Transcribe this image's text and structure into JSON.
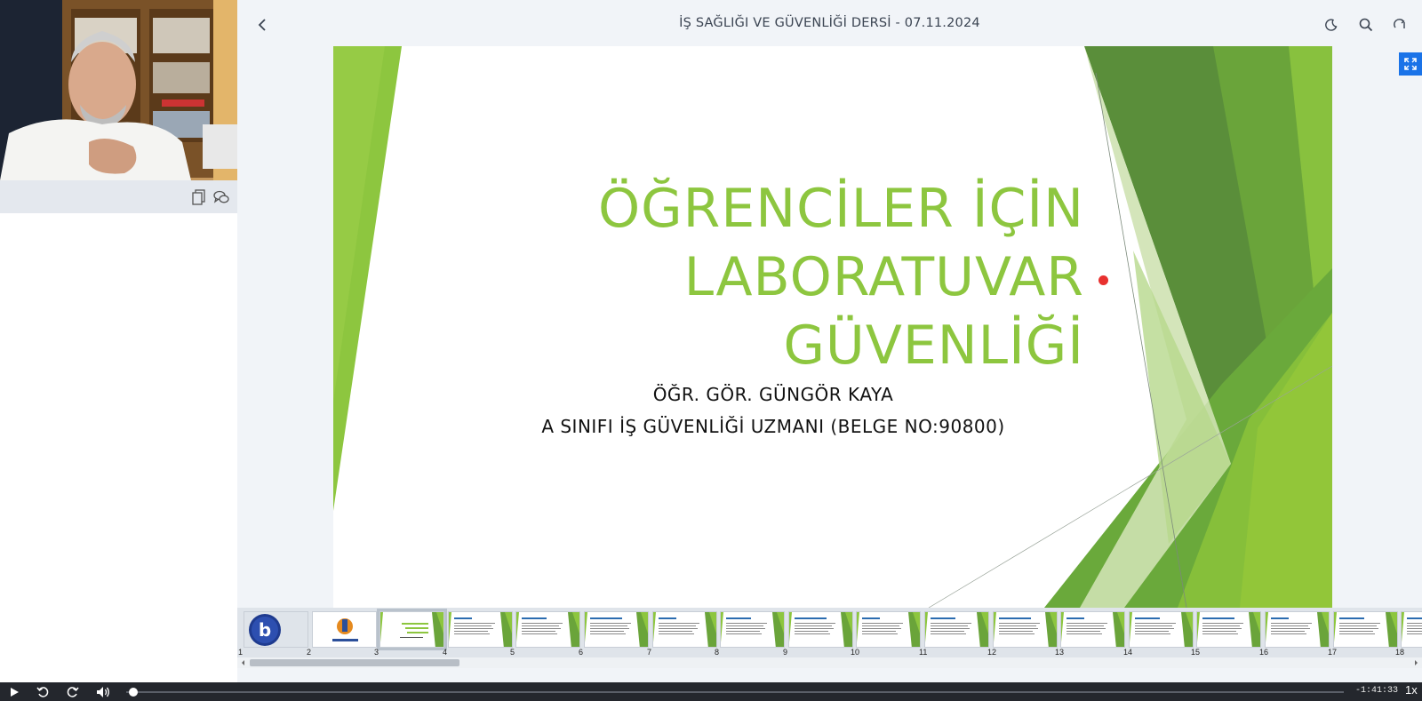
{
  "header": {
    "title": "İŞ SAĞLIĞI VE GÜVENLİĞİ DERSİ - 07.11.2024",
    "icons": [
      "chevron-left-icon",
      "moon-icon",
      "search-icon",
      "swap-icon"
    ]
  },
  "webcam": {
    "icons": [
      "copy-notes-icon",
      "chat-icon"
    ]
  },
  "slide": {
    "title_lines": [
      "ÖĞRENCİLER İÇİN",
      "LABORATUVAR",
      "GÜVENLİĞİ"
    ],
    "author": "ÖĞR. GÖR. GÜNGÖR KAYA",
    "credential": "A SINIFI İŞ GÜVENLİĞİ UZMANI (BELGE NO:90800)",
    "accent_color": "#8dc63f"
  },
  "thumbnails": {
    "numbers": [
      "1",
      "2",
      "3",
      "4",
      "5",
      "6",
      "7",
      "8",
      "9",
      "10",
      "11",
      "12",
      "13",
      "14",
      "15",
      "16",
      "17",
      "18"
    ],
    "active": "3"
  },
  "player": {
    "time_remaining": "-1:41:33",
    "speed": "1x",
    "progress_fraction": 0.006
  }
}
